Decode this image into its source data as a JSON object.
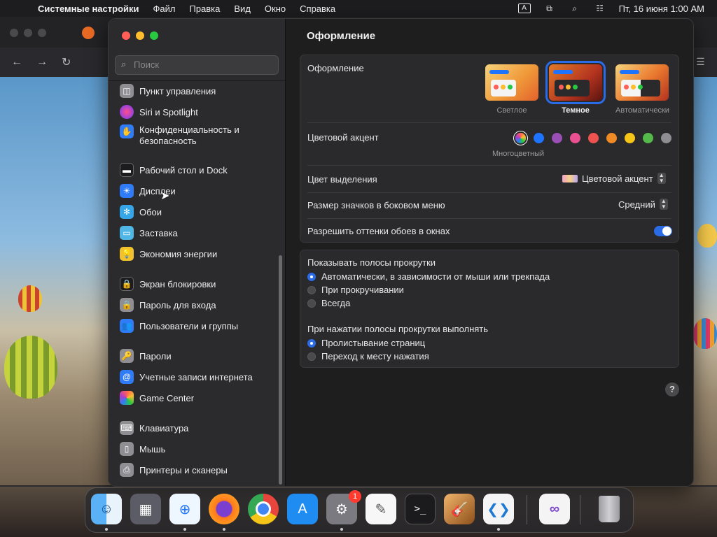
{
  "menubar": {
    "app_name": "Системные настройки",
    "items": [
      "Файл",
      "Правка",
      "Вид",
      "Окно",
      "Справка"
    ],
    "input_source": "A",
    "datetime": "Пт, 16 июня  1:00 AM"
  },
  "window": {
    "search_placeholder": "Поиск",
    "sidebar_items": [
      {
        "label": "Пункт управления",
        "icon": "control-center-icon",
        "color": "#8e8e93"
      },
      {
        "label": "Siri и Spotlight",
        "icon": "siri-icon",
        "color": "#b33cc8"
      },
      {
        "label": "Конфиденциальность и безопасность",
        "icon": "hand-icon",
        "color": "#2f7cf6"
      },
      {
        "label": "Рабочий стол и Dock",
        "icon": "dock-icon",
        "color": "#2b2b2d"
      },
      {
        "label": "Дисплеи",
        "icon": "display-icon",
        "color": "#2f7cf6"
      },
      {
        "label": "Обои",
        "icon": "wallpaper-icon",
        "color": "#35a7e8"
      },
      {
        "label": "Заставка",
        "icon": "screensaver-icon",
        "color": "#4fb6e6"
      },
      {
        "label": "Экономия энергии",
        "icon": "bulb-icon",
        "color": "#f2c12e"
      },
      {
        "label": "Экран блокировки",
        "icon": "lock-screen-icon",
        "color": "#2b2b2d"
      },
      {
        "label": "Пароль для входа",
        "icon": "lock-icon",
        "color": "#8e8e93"
      },
      {
        "label": "Пользователи и группы",
        "icon": "users-icon",
        "color": "#2f7cf6"
      },
      {
        "label": "Пароли",
        "icon": "key-icon",
        "color": "#8e8e93"
      },
      {
        "label": "Учетные записи интернета",
        "icon": "at-icon",
        "color": "#2f7cf6"
      },
      {
        "label": "Game Center",
        "icon": "game-center-icon",
        "color": "#ffffff"
      },
      {
        "label": "Клавиатура",
        "icon": "keyboard-icon",
        "color": "#8e8e93"
      },
      {
        "label": "Мышь",
        "icon": "mouse-icon",
        "color": "#8e8e93"
      },
      {
        "label": "Принтеры и сканеры",
        "icon": "printer-icon",
        "color": "#8e8e93"
      }
    ]
  },
  "content": {
    "title": "Оформление",
    "appearance": {
      "label": "Оформление",
      "options": [
        "Светлое",
        "Темное",
        "Автоматически"
      ],
      "selected": "Темное"
    },
    "accent": {
      "label": "Цветовой акцент",
      "selected_caption": "Многоцветный",
      "colors": [
        "multicolor",
        "#1e74ff",
        "#9a4fb4",
        "#e8508f",
        "#ef5350",
        "#f08a25",
        "#f5c518",
        "#55b84a",
        "#8e8e93"
      ]
    },
    "highlight": {
      "label": "Цвет выделения",
      "value": "Цветовой акцент"
    },
    "sidebar_icon_size": {
      "label": "Размер значков в боковом меню",
      "value": "Средний"
    },
    "wallpaper_tint": {
      "label": "Разрешить оттенки обоев в окнах",
      "enabled": true
    },
    "scrollbars": {
      "label": "Показывать полосы прокрутки",
      "options": [
        "Автоматически, в зависимости от мыши или трекпада",
        "При прокручивании",
        "Всегда"
      ],
      "selected": 0
    },
    "click_scrollbar": {
      "label": "При нажатии полосы прокрутки выполнять",
      "options": [
        "Пролистывание страниц",
        "Переход к месту нажатия"
      ],
      "selected": 0
    },
    "help": "?"
  },
  "dock": {
    "apps": [
      "finder",
      "launchpad",
      "safari",
      "firefox",
      "chrome",
      "app-store",
      "system-settings",
      "textedit",
      "terminal",
      "garageband",
      "vscode",
      "visual-studio",
      "trash"
    ],
    "settings_badge": "1"
  }
}
